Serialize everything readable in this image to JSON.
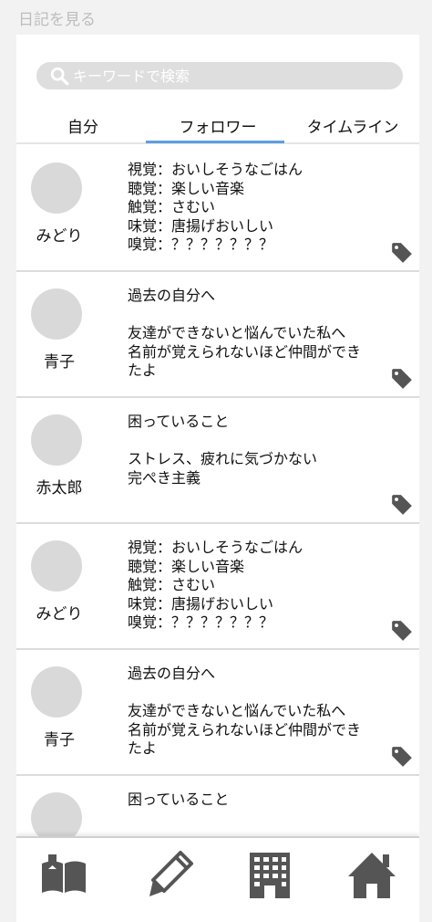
{
  "header": {
    "title": "日記を見る"
  },
  "search": {
    "placeholder": "キーワードで検索"
  },
  "tabs": [
    {
      "label": "自分",
      "selected": false
    },
    {
      "label": "フォロワー",
      "selected": true
    },
    {
      "label": "タイムライン",
      "selected": false
    }
  ],
  "posts": [
    {
      "author": "みどり",
      "text": "視覚：おいしそうなごはん\n聴覚：楽しい音楽\n触覚：さむい\n味覚：唐揚げおいしい\n嗅覚：？？？？？？？"
    },
    {
      "author": "青子",
      "text": "過去の自分へ\n\n友達ができないと悩んでいた私へ\n名前が覚えられないほど仲間ができ\nたよ"
    },
    {
      "author": "赤太郎",
      "text": "困っていること\n\nストレス、疲れに気づかない\n完ぺき主義"
    },
    {
      "author": "みどり",
      "text": "視覚：おいしそうなごはん\n聴覚：楽しい音楽\n触覚：さむい\n味覚：唐揚げおいしい\n嗅覚：？？？？？？？"
    },
    {
      "author": "青子",
      "text": "過去の自分へ\n\n友達ができないと悩んでいた私へ\n名前が覚えられないほど仲間ができ\nたよ"
    },
    {
      "author": "",
      "text": "困っていること"
    }
  ],
  "icons": {
    "search": "search-icon",
    "tag": "tag-icon",
    "nav": [
      "book-icon",
      "pencil-icon",
      "building-icon",
      "home-icon"
    ]
  },
  "colors": {
    "accent": "#5e9fe0",
    "search_bg": "#dedede",
    "avatar": "#d9d9d9",
    "icon": "#555555",
    "background": "#f2f2f2"
  }
}
